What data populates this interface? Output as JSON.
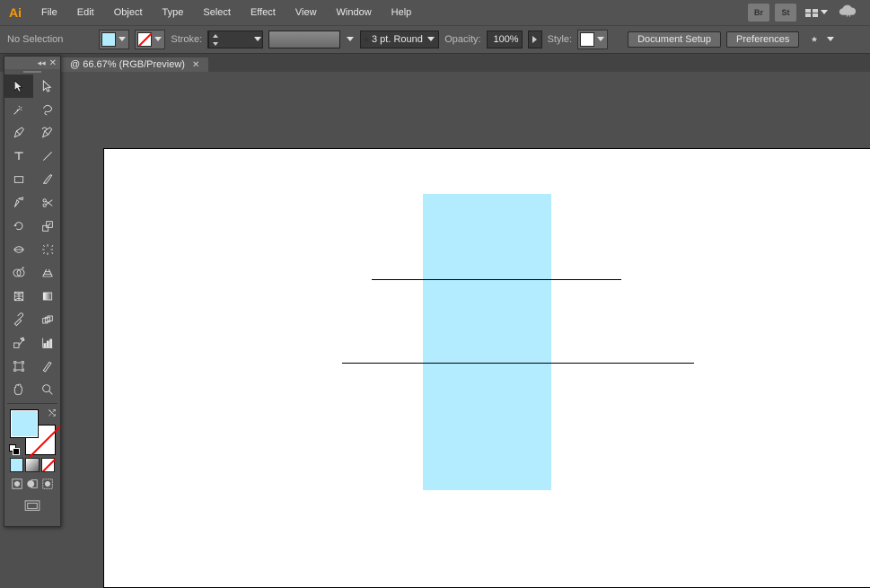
{
  "menu": {
    "items": [
      "File",
      "Edit",
      "Object",
      "Type",
      "Select",
      "Effect",
      "View",
      "Window",
      "Help"
    ]
  },
  "top_icons": {
    "br": "Br",
    "st": "St"
  },
  "control": {
    "selection_status": "No Selection",
    "fill_color": "#b3ecff",
    "stroke_none": true,
    "stroke_label": "Stroke:",
    "stroke_value": "",
    "profile_label": "3 pt. Round",
    "opacity_label": "Opacity:",
    "opacity_value": "100%",
    "style_label": "Style:",
    "doc_setup": "Document Setup",
    "prefs": "Preferences"
  },
  "tab": {
    "title": "@ 66.67% (RGB/Preview)"
  },
  "colors": {
    "fill": "#b3ecff",
    "artboard_bg": "#ffffff",
    "canvas_bg": "#4f4f4f"
  }
}
